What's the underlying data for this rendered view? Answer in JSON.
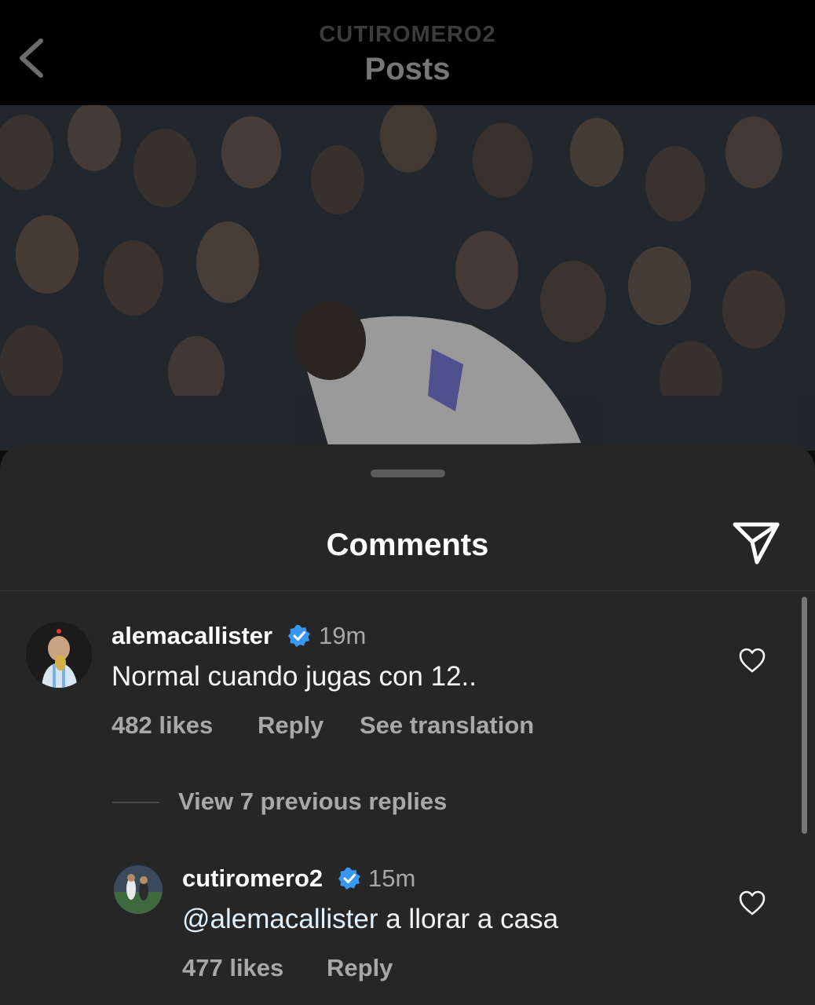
{
  "header": {
    "username": "CUTIROMERO2",
    "title": "Posts"
  },
  "comments_sheet": {
    "title": "Comments",
    "comments": [
      {
        "username": "alemacallister",
        "time": "19m",
        "text": "Normal cuando jugas con 12..",
        "likes": "482 likes",
        "reply": "Reply",
        "see_translation": "See translation"
      }
    ],
    "view_replies": "View 7 previous replies",
    "reply": {
      "username": "cutiromero2",
      "time": "15m",
      "mention": "@alemacallister",
      "text": " a llorar a casa",
      "likes": "477 likes",
      "reply": "Reply"
    }
  },
  "colors": {
    "verified_badge": "#3897f0",
    "sheet_background": "#262626",
    "secondary_text": "#a8a8a8"
  },
  "icons": [
    "back-chevron-icon",
    "share-icon",
    "verified-badge-icon",
    "heart-icon"
  ]
}
